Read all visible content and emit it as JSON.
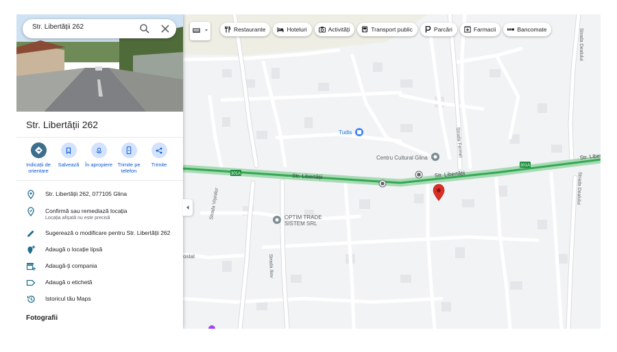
{
  "search": {
    "value": "Str. Libertății 262"
  },
  "place": {
    "title": "Str. Libertății 262"
  },
  "actions": [
    {
      "label": "Indicații de orientare"
    },
    {
      "label": "Salvează"
    },
    {
      "label": "În apropiere"
    },
    {
      "label": "Trimite pe telefon"
    },
    {
      "label": "Trimite"
    }
  ],
  "info": [
    {
      "text": "Str. Libertății 262, 077105 Glina"
    },
    {
      "text": "Confirmă sau remediază locația",
      "sub": "Locația afișată nu este precisă"
    },
    {
      "text": "Sugerează o modificare pentru Str. Libertății 262"
    },
    {
      "text": "Adaugă o locație lipsă"
    },
    {
      "text": "Adaugă-ți compania"
    },
    {
      "text": "Adaugă o etichetă"
    },
    {
      "text": "Istoricul tău Maps"
    }
  ],
  "photos_heading": "Fotografii",
  "chips": [
    {
      "label": "Restaurante",
      "icon": "fork-knife-icon"
    },
    {
      "label": "Hoteluri",
      "icon": "bed-icon"
    },
    {
      "label": "Activități",
      "icon": "camera-icon"
    },
    {
      "label": "Transport public",
      "icon": "bus-icon"
    },
    {
      "label": "Parcări",
      "icon": "parking-icon"
    },
    {
      "label": "Farmacii",
      "icon": "pharmacy-icon"
    },
    {
      "label": "Bancomate",
      "icon": "atm-icon"
    }
  ],
  "map": {
    "streets": {
      "main": "Str. Libertății",
      "main_right": "Str. Liber",
      "fermei": "Strada Fermei",
      "dealului_top": "Strada Dealului",
      "dealului_bottom": "Strada Dealului",
      "visinilor": "Strada Vișinilor",
      "iliov": "Strada Iliov"
    },
    "route_badge": "301A",
    "pois": {
      "tudis": "Tudis",
      "centru": "Centru Cultural Glina",
      "optim_line1": "OPTIM TRADE",
      "optim_line2": "SISTEM SRL",
      "postal": "ostal"
    },
    "colors": {
      "road_green": "#34a853",
      "pin": "#d93025",
      "route_badge": "#1e8e3e",
      "poi_blue": "#4285f4"
    }
  }
}
